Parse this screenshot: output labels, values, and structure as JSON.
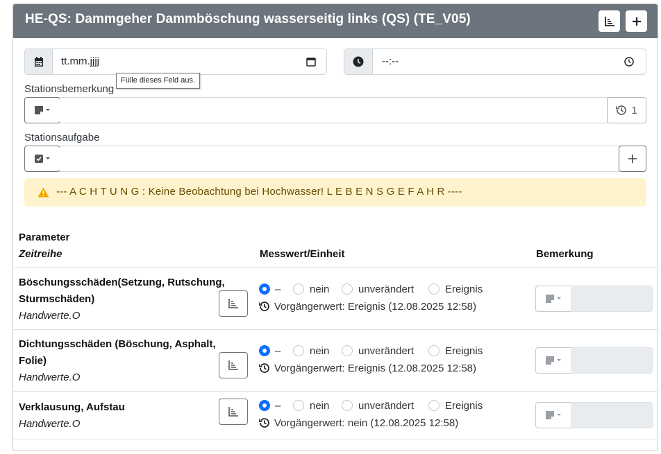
{
  "header": {
    "title": "HE-QS: Dammgeher Dammböschung wasserseitig links (QS) (TE_V05)",
    "chart_icon": "chart-icon",
    "add_icon": "plus-icon"
  },
  "date_field": {
    "value": "tt.mm.jjjj",
    "icon": "calendar-icon",
    "picker_icon": "calendar-picker-icon"
  },
  "time_field": {
    "value": "--:--",
    "icon": "clock-icon",
    "picker_icon": "clock-picker-icon"
  },
  "tooltip": "Fülle dieses Feld aus.",
  "stationsbemerkung": {
    "label": "Stationsbemerkung",
    "history_count": "1",
    "dropdown_icon": "note-icon",
    "history_icon": "history-icon"
  },
  "stationsaufgabe": {
    "label": "Stationsaufgabe",
    "dropdown_icon": "checkbox-icon",
    "add_icon": "plus-icon"
  },
  "alert": {
    "text": "--- A C H T U N G : Keine Beobachtung bei Hochwasser! L E B E N S G E F A H R ----",
    "icon": "warning-icon"
  },
  "table": {
    "headers": {
      "parameter": "Parameter",
      "zeitreihe": "Zeitreihe",
      "messwert": "Messwert/Einheit",
      "bemerkung": "Bemerkung"
    },
    "radio_options": [
      "–",
      "nein",
      "unverändert",
      "Ereignis"
    ],
    "rows": [
      {
        "name_line1": "Böschungsschäden(Setzung, Rutschung,",
        "name_line2": "Sturmschäden)",
        "series": "Handwerte.O",
        "selected": "–",
        "previous": "Vorgängerwert: Ereignis (12.08.2025 12:58)"
      },
      {
        "name_line1": "Dichtungsschäden (Böschung, Asphalt,",
        "name_line2": "Folie)",
        "series": "Handwerte.O",
        "selected": "–",
        "previous": "Vorgängerwert: Ereignis (12.08.2025 12:58)"
      },
      {
        "name_line1": "Verklausung, Aufstau",
        "name_line2": "",
        "series": "Handwerte.O",
        "selected": "–",
        "previous": "Vorgängerwert: nein (12.08.2025 12:58)"
      }
    ]
  },
  "colors": {
    "header_bg": "#6c757d",
    "alert_bg": "#fff3cd",
    "radio_checked": "#0d6efd"
  }
}
